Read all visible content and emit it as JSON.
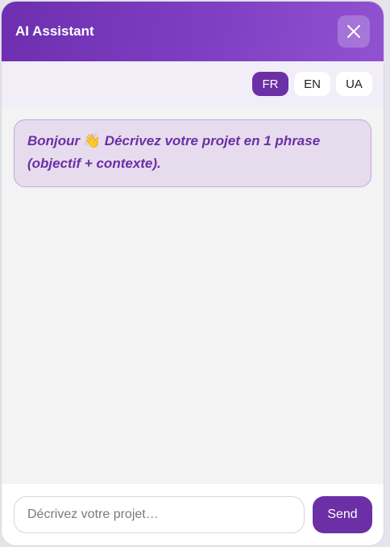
{
  "header": {
    "title": "AI Assistant",
    "close_icon": "close-icon"
  },
  "languages": {
    "items": [
      {
        "label": "FR",
        "active": true
      },
      {
        "label": "EN",
        "active": false
      },
      {
        "label": "UA",
        "active": false
      }
    ]
  },
  "messages": [
    {
      "role": "assistant",
      "text_before": "Bonjour ",
      "emoji": "👋",
      "text_after": " Décrivez votre projet en 1 phrase (objectif + contexte)."
    }
  ],
  "composer": {
    "placeholder": "Décrivez votre projet…",
    "value": "",
    "send_label": "Send"
  },
  "colors": {
    "accent": "#6b2fa6",
    "header_gradient_start": "#6d2fb0",
    "header_gradient_end": "#9152d1",
    "bubble_bg": "#e6dcee",
    "bubble_border": "#c3a6dd"
  }
}
